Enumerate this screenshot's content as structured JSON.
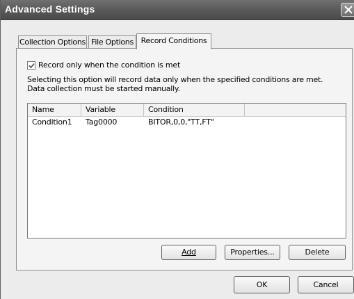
{
  "window": {
    "title": "Advanced Settings"
  },
  "tabs": [
    {
      "label": "Collection Options",
      "active": false
    },
    {
      "label": "File Options",
      "active": false
    },
    {
      "label": "Record Conditions",
      "active": true
    }
  ],
  "record_conditions": {
    "checkbox_label": "Record only when the condition is met",
    "checkbox_checked": true,
    "description_line1": "Selecting this option will record data only when the specified conditions are met.",
    "description_line2": "Data collection must be started manually.",
    "columns": [
      "Name",
      "Variable",
      "Condition",
      ""
    ],
    "rows": [
      {
        "name": "Condition1",
        "variable": "Tag0000",
        "condition": "BITOR,0,0,\"TT,FT\""
      }
    ],
    "buttons": {
      "add": "Add",
      "properties": "Properties...",
      "delete": "Delete"
    }
  },
  "footer": {
    "ok": "OK",
    "cancel": "Cancel"
  }
}
